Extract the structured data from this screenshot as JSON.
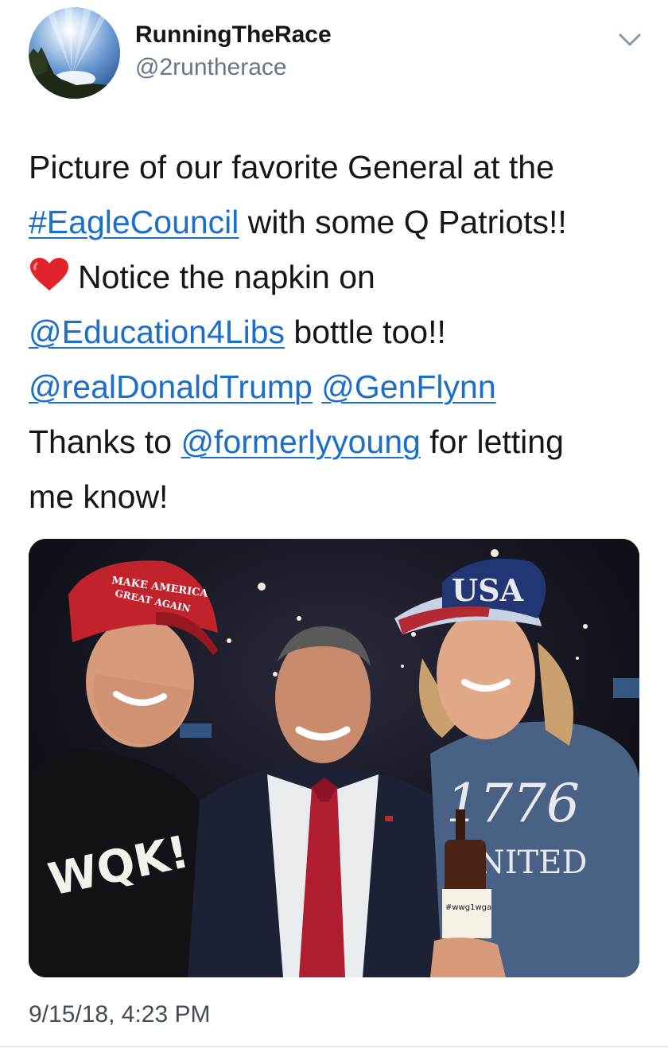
{
  "user": {
    "display_name": "RunningTheRace",
    "handle": "@2runtherace",
    "avatar_icon": "sky-sunrise-avatar"
  },
  "menu": {
    "icon": "chevron-down-icon"
  },
  "tweet": {
    "line1": "Picture of our favorite General at the",
    "hashtag": "#EagleCouncil",
    "line2_rest": " with some Q Patriots!!",
    "line3_text": "Notice the napkin on",
    "mention_education": "@Education4Libs",
    "line4_rest": " bottle too!!",
    "mention_trump": "@realDonaldTrump",
    "mention_flynn": "@GenFlynn",
    "line6_prefix": "Thanks to ",
    "mention_formerly": "@formerlyyoung",
    "line6_suffix": " for letting",
    "line7": "me know!"
  },
  "photo": {
    "hat_left_text_1": "MAKE AMERICA",
    "hat_left_text_2": "GREAT AGAIN",
    "shirt_left_text": "WQK!",
    "cap_right_text": "USA",
    "shirt_right_text_1": "1776",
    "shirt_right_text_2": "UNITED",
    "bottle_label": "#wwg1wga"
  },
  "timestamp": "9/15/18, 4:23 PM",
  "colors": {
    "link": "#1b6ec9",
    "text": "#14171a",
    "secondary": "#657786"
  }
}
